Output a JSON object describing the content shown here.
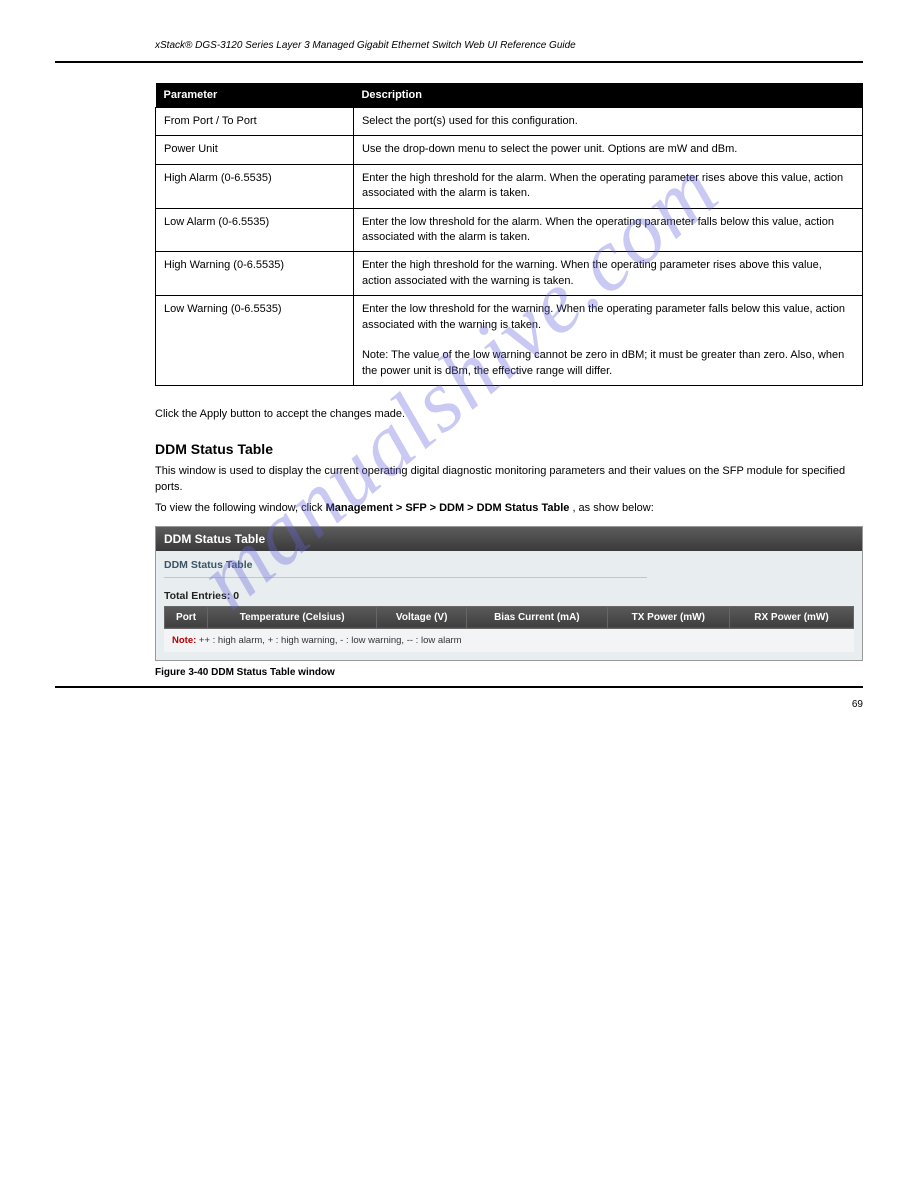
{
  "header_line": "xStack® DGS-3120 Series Layer 3 Managed Gigabit Ethernet Switch Web UI Reference Guide",
  "watermark": "manualshive.com",
  "param_table": {
    "headers": [
      "Parameter",
      "Description"
    ],
    "rows": [
      {
        "param": "From Port / To Port",
        "desc": "Select the port(s) used for this configuration."
      },
      {
        "param": "Power Unit",
        "desc": "Use the drop-down menu to select the power unit. Options are mW and dBm."
      },
      {
        "param": "High Alarm (0-6.5535)",
        "desc": "Enter the high threshold for the alarm. When the operating parameter rises above this value, action associated with the alarm is taken."
      },
      {
        "param": "Low Alarm (0-6.5535)",
        "desc": "Enter the low threshold for the alarm. When the operating parameter falls below this value, action associated with the alarm is taken."
      },
      {
        "param": "High Warning (0-6.5535)",
        "desc": "Enter the high threshold for the warning. When the operating parameter rises above this value, action associated with the warning is taken."
      },
      {
        "param": "Low Warning (0-6.5535)",
        "desc": "Enter the low threshold for the warning. When the operating parameter falls below this value, action associated with the warning is taken.\n\nNote: The value of the low warning cannot be zero in dBM; it must be greater than zero. Also, when the power unit is dBm, the effective range will differ."
      }
    ]
  },
  "apply_text": "Click the Apply button to accept the changes made.",
  "section_title": "DDM Status Table",
  "section_desc": "This window is used to display the current operating digital diagnostic monitoring parameters and their values on the SFP module for specified ports.",
  "navpath": {
    "prefix": "To view the following window, click ",
    "path": "Management > SFP > DDM > DDM Status Table",
    "suffix": ", as show below:"
  },
  "ddm_box": {
    "title": "DDM Status Table",
    "subtitle": "DDM Status Table",
    "total": "Total Entries: 0",
    "columns": [
      "Port",
      "Temperature (Celsius)",
      "Voltage (V)",
      "Bias Current (mA)",
      "TX Power (mW)",
      "RX Power (mW)"
    ],
    "note_label": "Note:",
    "note_text": " ++ : high alarm, + : high warning, - : low warning, -- : low alarm"
  },
  "figure_caption": "Figure 3-40 DDM Status Table window",
  "page_number": "69"
}
